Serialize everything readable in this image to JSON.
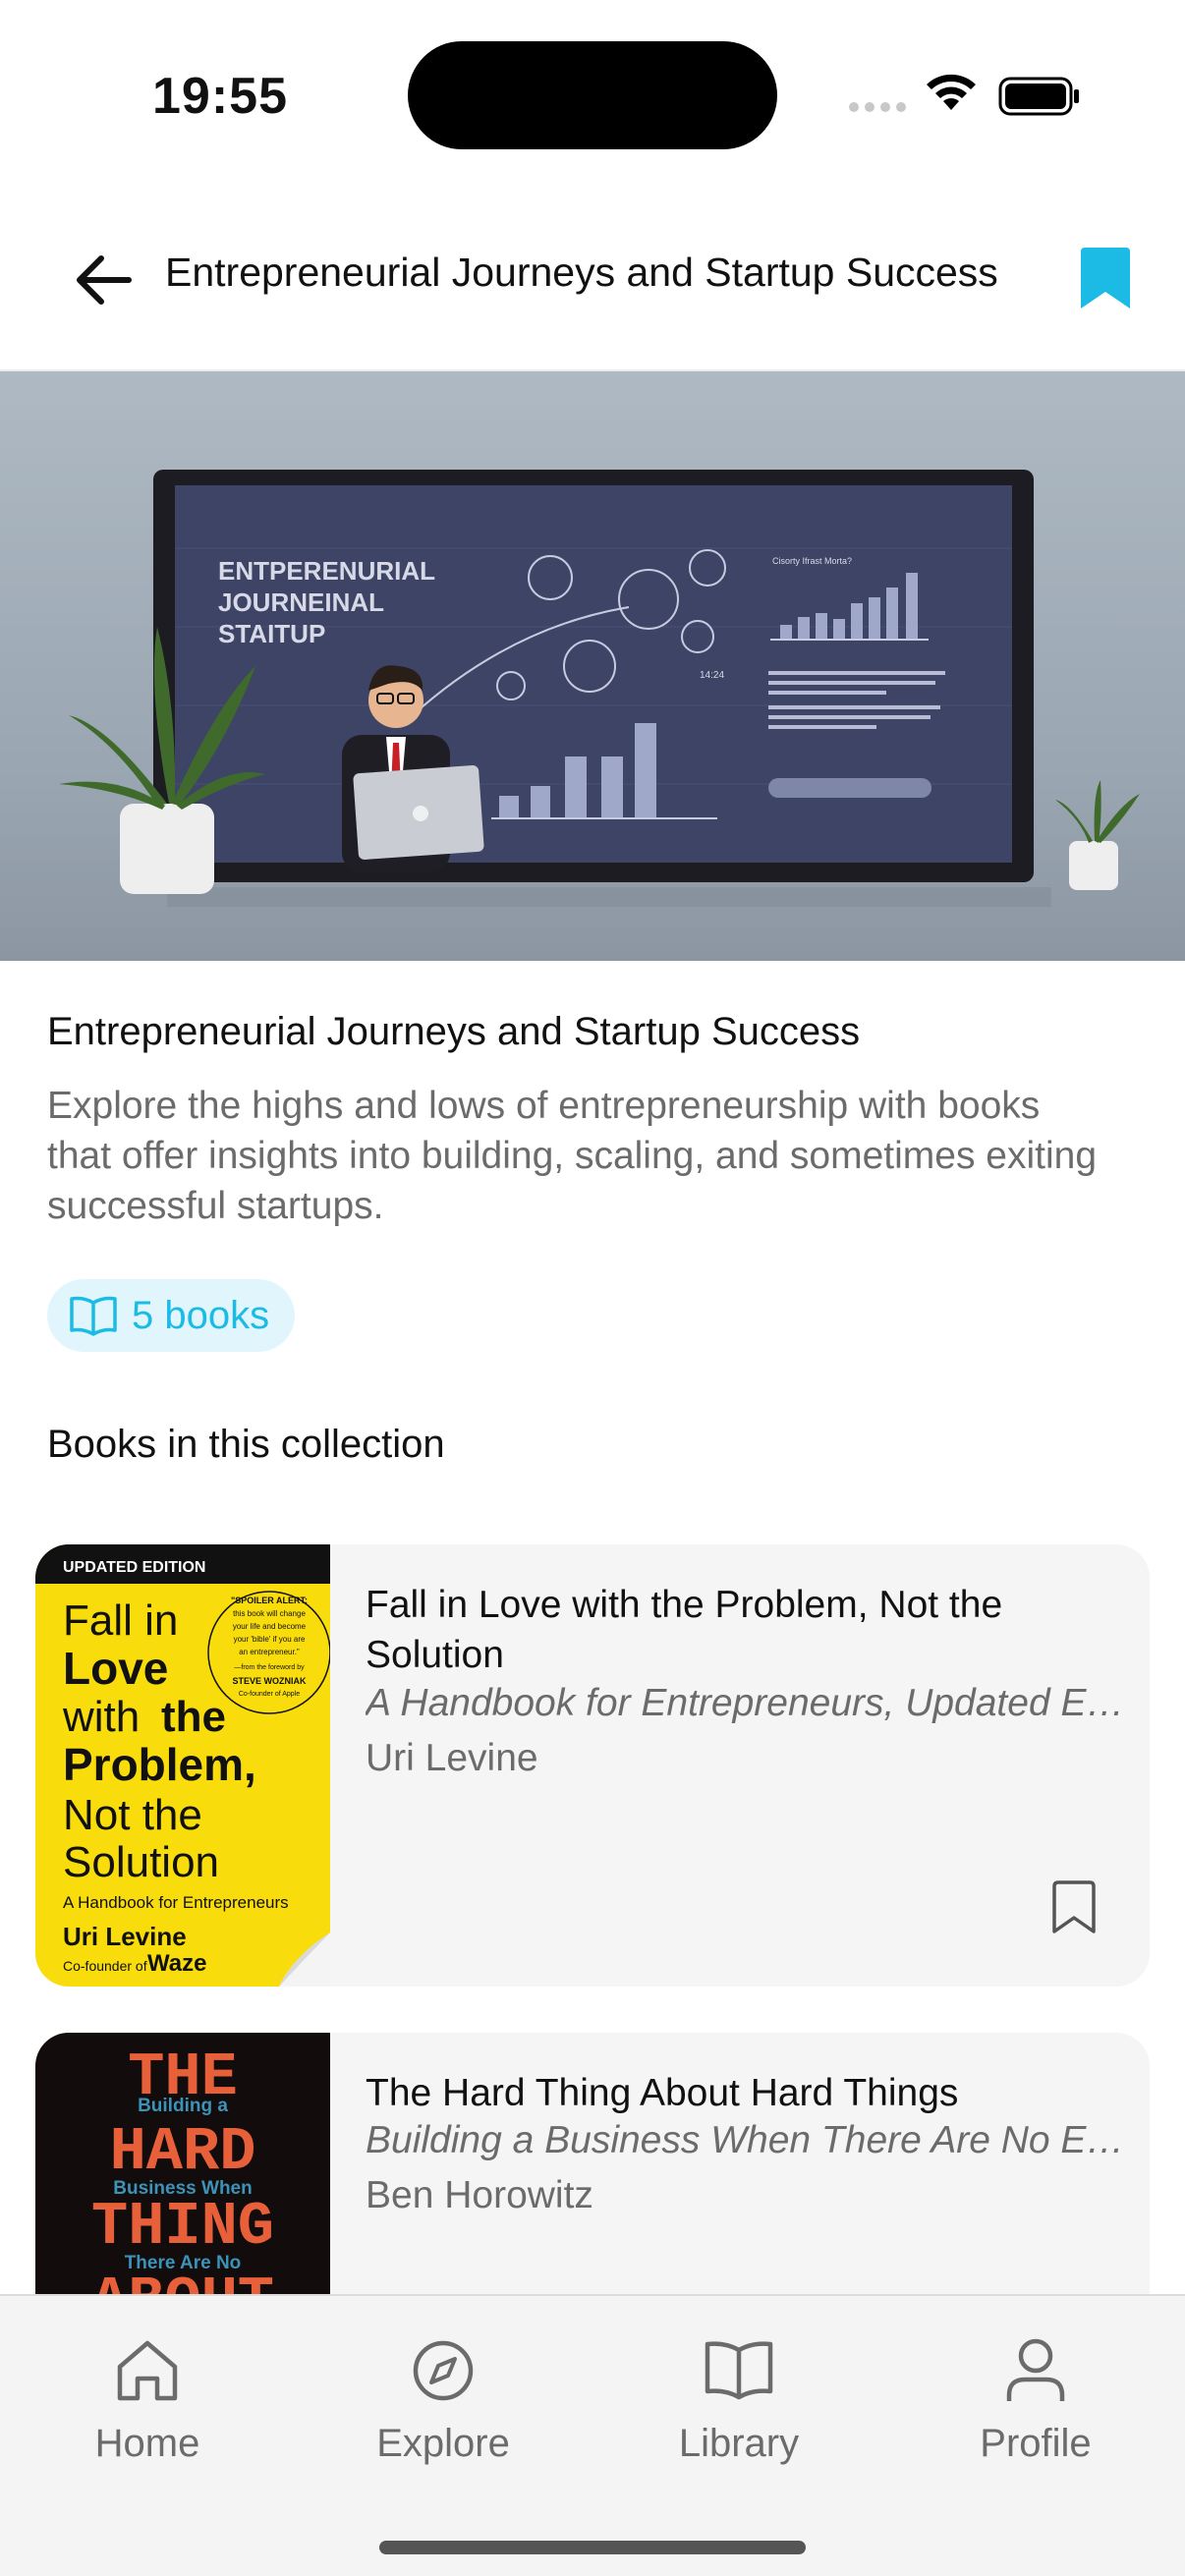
{
  "status_bar": {
    "time": "19:55"
  },
  "header": {
    "title": "Entrepreneurial Journeys and Startup Success",
    "accent_color": "#1bbbe6"
  },
  "hero": {
    "screen_heading_lines": [
      "ENTPERENURIAL",
      "JOURNEINAL",
      "STAITUP"
    ],
    "screen_chart_heading": "Cisorty Ifrast Morta?",
    "screen_stat": "14:24"
  },
  "collection": {
    "title": "Entrepreneurial Journeys and Startup Success",
    "description": "Explore the highs and lows of entrepreneurship with books that offer insights into building, scaling, and sometimes exiting successful startups.",
    "book_count_label": "5 books",
    "section_title": "Books in this collection"
  },
  "books": [
    {
      "title": "Fall in Love with the Problem, Not the Solution",
      "subtitle": "A Handbook for Entrepreneurs, Updated Edition",
      "author": "Uri Levine",
      "cover": {
        "banner": "UPDATED EDITION",
        "line1": "Fall in",
        "line2": "Love",
        "line3a": "with",
        "line3b": "the",
        "line4": "Problem,",
        "line5": "Not the",
        "line6": "Solution",
        "tagline": "A Handbook for Entrepreneurs",
        "author": "Uri Levine",
        "author_note_a": "Co-founder of",
        "author_note_b": "Waze",
        "badge_line1": "\"SPOILER ALERT:",
        "badge_line2": "this book will change",
        "badge_line3": "your life and become",
        "badge_line4": "your 'bible' if you are",
        "badge_line5": "an entrepreneur.\"",
        "badge_line6": "—from the foreword by",
        "badge_line7": "STEVE WOZNIAK",
        "badge_line8": "Co-founder of Apple",
        "bg_color": "#f8dc0b"
      }
    },
    {
      "title": "The Hard Thing About Hard Things",
      "subtitle": "Building a Business When There Are No Easy Answers",
      "author": "Ben Horowitz",
      "cover": {
        "w1": "THE",
        "s1": "Building a",
        "w2": "HARD",
        "s2": "Business When",
        "w3": "THING",
        "s3": "There Are No",
        "w4": "ABOUT",
        "bg_color": "#130c0c"
      }
    }
  ],
  "tab_bar": {
    "items": [
      {
        "label": "Home",
        "icon": "home-icon"
      },
      {
        "label": "Explore",
        "icon": "compass-icon"
      },
      {
        "label": "Library",
        "icon": "book-open-icon"
      },
      {
        "label": "Profile",
        "icon": "person-icon"
      }
    ]
  }
}
